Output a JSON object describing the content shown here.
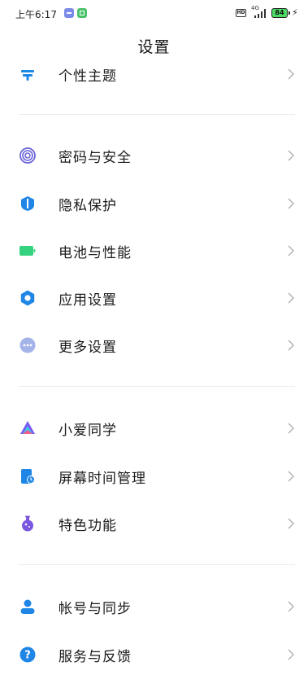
{
  "status_bar": {
    "time": "上午6:17",
    "hd": "HD",
    "network": "4G",
    "battery": "84"
  },
  "header": {
    "title": "设置"
  },
  "rows": [
    {
      "label": "个性主题",
      "icon": "theme-icon",
      "color": "#1e88e5"
    },
    {
      "label": "密码与安全",
      "icon": "fingerprint-icon",
      "color": "#6a63d8"
    },
    {
      "label": "隐私保护",
      "icon": "privacy-shield-icon",
      "color": "#1f86e6"
    },
    {
      "label": "电池与性能",
      "icon": "battery-icon",
      "color": "#34d27e"
    },
    {
      "label": "应用设置",
      "icon": "app-settings-gear-icon",
      "color": "#1f86e6"
    },
    {
      "label": "更多设置",
      "icon": "more-dots-icon",
      "color": "#a4b3e8"
    },
    {
      "label": "小爱同学",
      "icon": "xiaoai-icon",
      "color": "#7a5cf0"
    },
    {
      "label": "屏幕时间管理",
      "icon": "screen-time-icon",
      "color": "#1f86e6"
    },
    {
      "label": "特色功能",
      "icon": "special-features-flask-icon",
      "color": "#7b57e0"
    },
    {
      "label": "帐号与同步",
      "icon": "account-icon",
      "color": "#1f86e6"
    },
    {
      "label": "服务与反馈",
      "icon": "help-feedback-icon",
      "color": "#1f86e6"
    }
  ]
}
